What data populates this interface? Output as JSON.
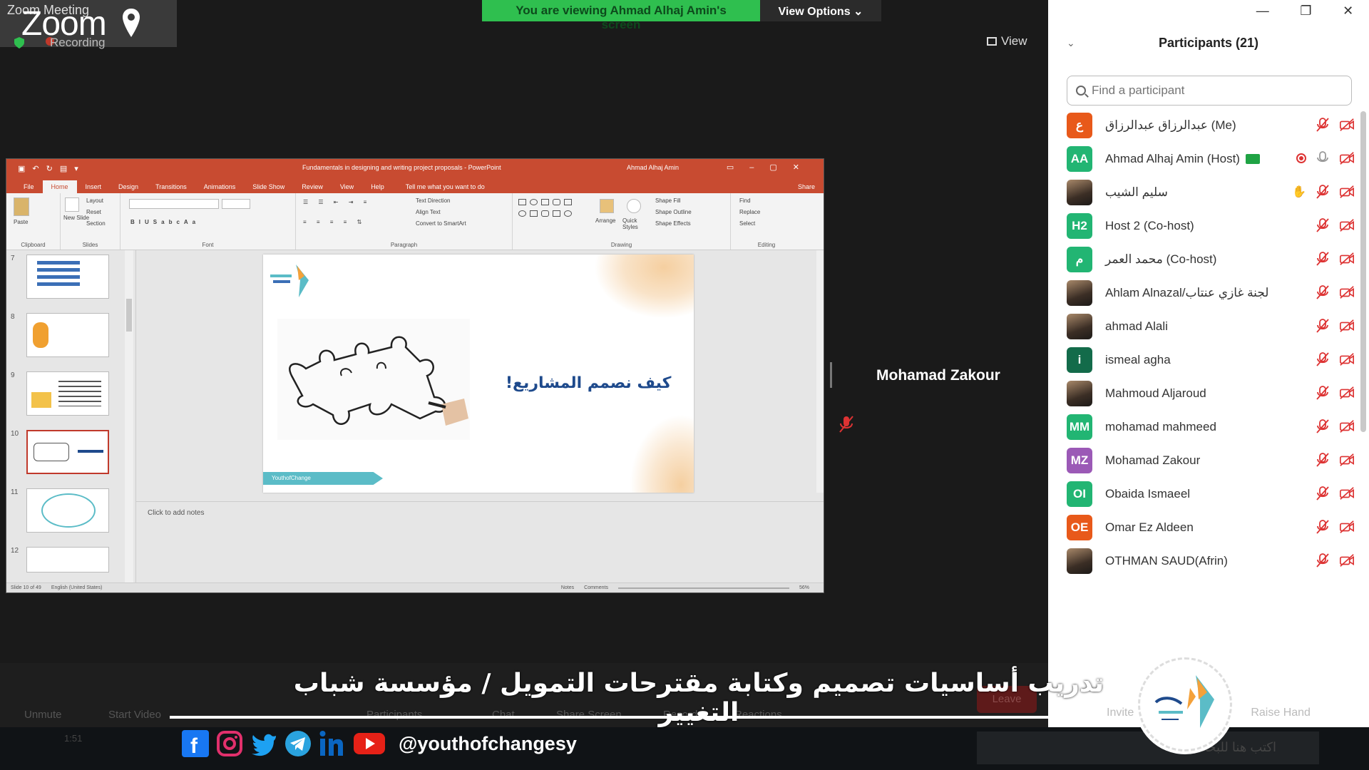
{
  "zoom": {
    "window_title": "Zoom Meeting",
    "logo_text": "Zoom",
    "recording_label": "Recording"
  },
  "share_banner": {
    "viewing_text": "You are viewing Ahmad Alhaj Amin's screen",
    "view_options_label": "View Options ⌄"
  },
  "view_button_label": "View",
  "powerpoint": {
    "doc_title": "Fundamentals in designing and writing project proposals - PowerPoint",
    "user_name": "Ahmad Alhaj Amin",
    "tabs": [
      "File",
      "Home",
      "Insert",
      "Design",
      "Transitions",
      "Animations",
      "Slide Show",
      "Review",
      "View",
      "Help"
    ],
    "active_tab": "Home",
    "tell_me": "Tell me what you want to do",
    "share_label": "Share",
    "ribbon": {
      "clipboard": "Clipboard",
      "paste": "Paste",
      "slides": "Slides",
      "new_slide": "New Slide",
      "layout": "Layout",
      "reset": "Reset",
      "section": "Section",
      "font": "Font",
      "paragraph": "Paragraph",
      "text_direction": "Text Direction",
      "align_text": "Align Text",
      "convert_smartart": "Convert to SmartArt",
      "drawing": "Drawing",
      "arrange": "Arrange",
      "quick_styles": "Quick Styles",
      "shape_fill": "Shape Fill",
      "shape_outline": "Shape Outline",
      "shape_effects": "Shape Effects",
      "editing": "Editing",
      "find": "Find",
      "replace": "Replace",
      "select": "Select"
    },
    "slide_numbers": [
      "7",
      "8",
      "9",
      "10",
      "11",
      "12"
    ],
    "selected_slide": "10",
    "slide_heading": "كيف نصمم المشاريع!",
    "slide_footer": "YouthofChange",
    "notes_placeholder": "Click to add notes",
    "status": {
      "slide_of": "Slide 10 of 49",
      "language": "English (United States)",
      "notes": "Notes",
      "comments": "Comments",
      "zoom": "56%"
    }
  },
  "speaker_name": "Mohamad Zakour",
  "participants": {
    "header": "Participants (21)",
    "search_placeholder": "Find a participant",
    "list": [
      {
        "initials": "ع",
        "name": "عبدالرزاق عبدالرزاق (Me)",
        "color": "#e8591a",
        "photo": false
      },
      {
        "initials": "AA",
        "name": "Ahmad Alhaj Amin (Host)",
        "color": "#22b573",
        "photo": false,
        "host": true
      },
      {
        "initials": "",
        "name": "سليم الشيب",
        "color": "#7a6652",
        "photo": true,
        "hand": true
      },
      {
        "initials": "H2",
        "name": "Host 2 (Co-host)",
        "color": "#22b573",
        "photo": false
      },
      {
        "initials": "م",
        "name": "محمد العمر (Co-host)",
        "color": "#22b573",
        "photo": false
      },
      {
        "initials": "",
        "name": "Ahlam Alnazal/لجنة غازي عنتاب",
        "color": "#7a6652",
        "photo": true
      },
      {
        "initials": "",
        "name": "ahmad Alali",
        "color": "#7a6652",
        "photo": true
      },
      {
        "initials": "i",
        "name": "ismeal agha",
        "color": "#136b4a",
        "photo": false
      },
      {
        "initials": "",
        "name": "Mahmoud Aljaroud",
        "color": "#7a6652",
        "photo": true
      },
      {
        "initials": "MM",
        "name": "mohamad mahmeed",
        "color": "#22b573",
        "photo": false
      },
      {
        "initials": "MZ",
        "name": "Mohamad Zakour",
        "color": "#9b59b6",
        "photo": false
      },
      {
        "initials": "OI",
        "name": "Obaida Ismaeel",
        "color": "#22b573",
        "photo": false
      },
      {
        "initials": "OE",
        "name": "Omar Ez Aldeen",
        "color": "#e8591a",
        "photo": false
      },
      {
        "initials": "",
        "name": "OTHMAN SAUD(Afrin)",
        "color": "#7a6652",
        "photo": true
      }
    ],
    "footer": [
      "Invite",
      "Raise Hand"
    ]
  },
  "toolbar": {
    "unmute": "Unmute",
    "start_video": "Start Video",
    "participants": "Participants",
    "chat": "Chat",
    "share_screen": "Share Screen",
    "record": "Record",
    "reactions": "Reactions",
    "leave": "Leave"
  },
  "taskbar": {
    "clock_time": "1:51",
    "search_text": "اكتب هنا للبحث"
  },
  "overlay": {
    "title": "تدريب أساسيات تصميم وكتابة مقترحات التمويل / مؤسسة شباب التغيير",
    "handle": "@youthofchangesy"
  }
}
